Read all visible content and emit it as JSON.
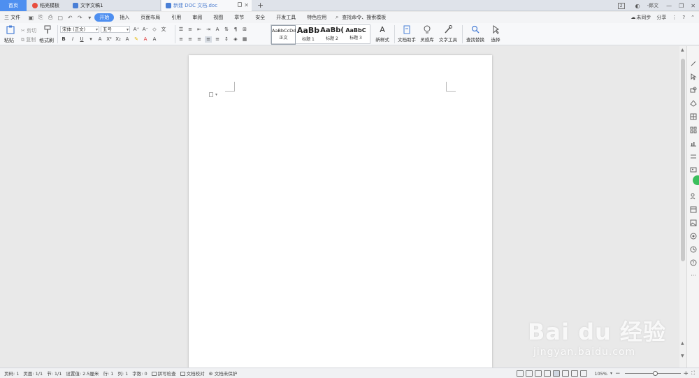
{
  "tabs": {
    "home": "首页",
    "items": [
      {
        "label": "稻壳模板"
      },
      {
        "label": "文字文稿1"
      },
      {
        "label": "新建 DOC 文档.doc"
      }
    ],
    "add": "+"
  },
  "window": {
    "badge": "2",
    "user": "-郎文"
  },
  "menu": {
    "file": "三 文件",
    "items": [
      "开始",
      "插入",
      "页面布局",
      "引用",
      "审阅",
      "视图",
      "章节",
      "安全",
      "开发工具",
      "特色应用"
    ],
    "active_index": 0,
    "search": "查找命令、搜索模板",
    "sync": "未同步",
    "share": "分享"
  },
  "ribbon": {
    "paste": "粘贴",
    "cut": "剪切",
    "copy": "复制",
    "format_painter": "格式刷",
    "font_name": "宋体 (正文)",
    "font_size": "五号",
    "styles": [
      {
        "sample": "AaBbCcDd",
        "label": "正文"
      },
      {
        "sample": "AaBb",
        "label": "标题 1"
      },
      {
        "sample": "AaBb(",
        "label": "标题 2"
      },
      {
        "sample": "AaBbC",
        "label": "标题 3"
      }
    ],
    "new_style": "新样式",
    "doc_assistant": "文档助手",
    "inspiration": "灵感库",
    "text_tools": "文字工具",
    "find_replace": "查找替换",
    "select": "选择"
  },
  "status": {
    "page": "页码: 1",
    "pages": "页面: 1/1",
    "section": "节: 1/1",
    "setting": "设置值: 2.5厘米",
    "row": "行: 1",
    "col": "列: 1",
    "words": "字数: 0",
    "spell": "拼写检查",
    "proof": "文档校对",
    "protect": "文档未保护",
    "zoom": "105%",
    "zoom_level": 0.55
  },
  "watermark": {
    "brand": "Bai du 经验",
    "url": "jingyan.baidu.com"
  }
}
